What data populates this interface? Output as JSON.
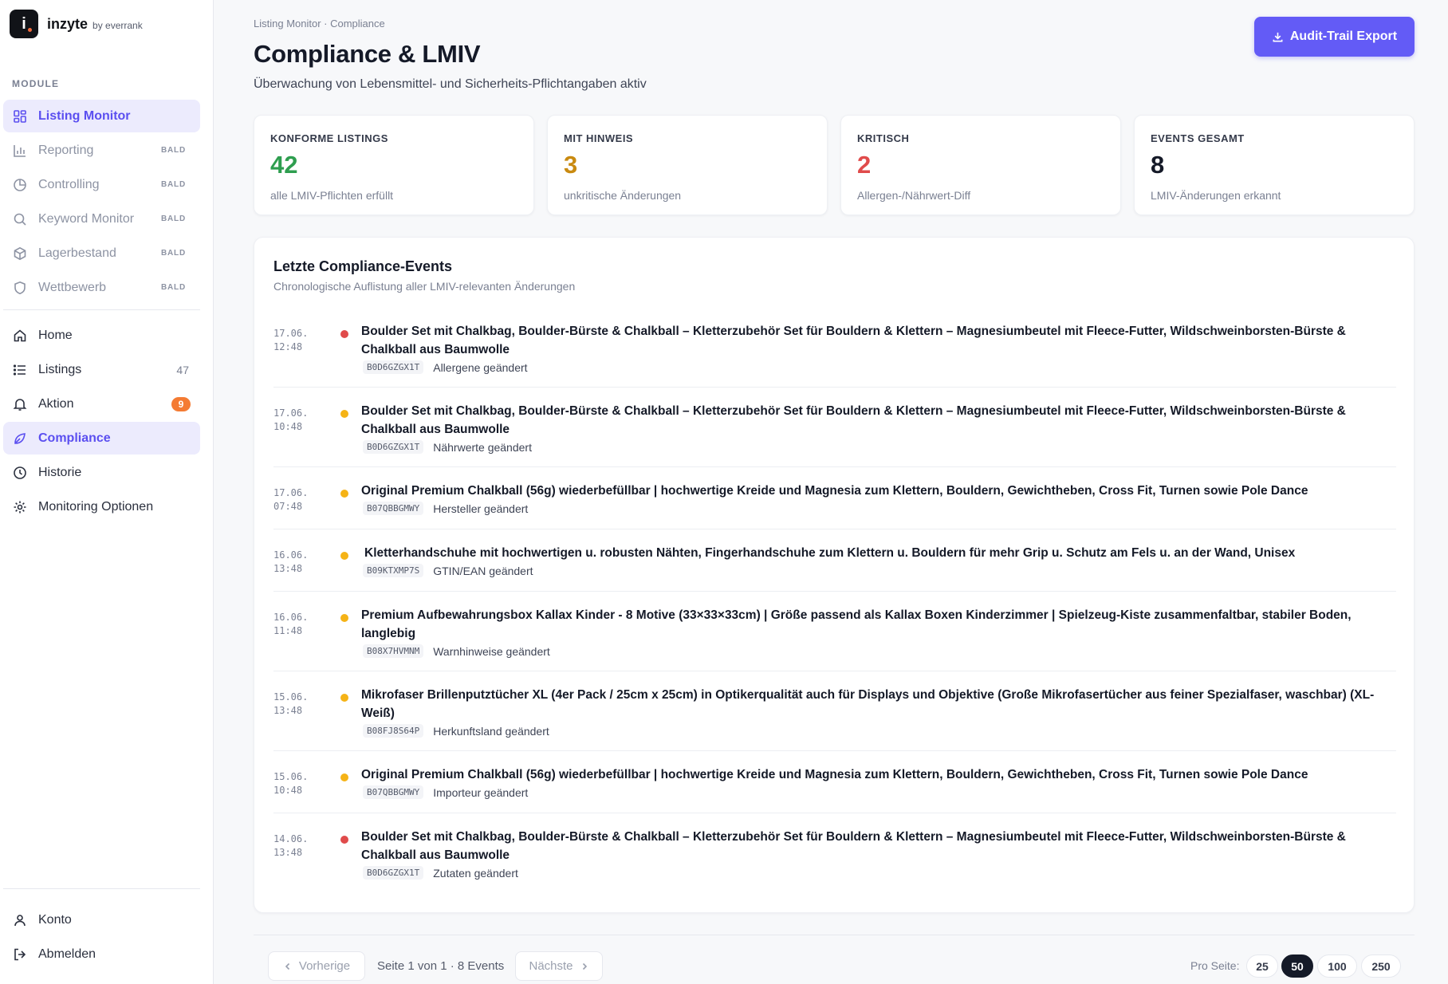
{
  "brand": {
    "name": "inzyte",
    "sub": "by everrank",
    "logo_letter": "i"
  },
  "sidebar": {
    "section_label": "MODULE",
    "modules": [
      {
        "label": "Listing Monitor",
        "icon": "grid-icon",
        "active": true,
        "tag": ""
      },
      {
        "label": "Reporting",
        "icon": "bar-chart-icon",
        "tag": "BALD"
      },
      {
        "label": "Controlling",
        "icon": "pie-chart-icon",
        "tag": "BALD"
      },
      {
        "label": "Keyword Monitor",
        "icon": "search-icon",
        "tag": "BALD"
      },
      {
        "label": "Lagerbestand",
        "icon": "box-icon",
        "tag": "BALD"
      },
      {
        "label": "Wettbewerb",
        "icon": "shield-icon",
        "tag": "BALD"
      }
    ],
    "nav": [
      {
        "label": "Home",
        "icon": "home-icon"
      },
      {
        "label": "Listings",
        "icon": "list-icon",
        "count": "47"
      },
      {
        "label": "Aktion",
        "icon": "bell-icon",
        "badge": "9"
      },
      {
        "label": "Compliance",
        "icon": "leaf-icon",
        "active": true
      },
      {
        "label": "Historie",
        "icon": "clock-icon"
      },
      {
        "label": "Monitoring Optionen",
        "icon": "gear-icon"
      }
    ],
    "bottom": [
      {
        "label": "Konto",
        "icon": "user-icon"
      },
      {
        "label": "Abmelden",
        "icon": "logout-icon"
      }
    ]
  },
  "header": {
    "breadcrumb": "Listing Monitor · Compliance",
    "title": "Compliance & LMIV",
    "subtitle": "Überwachung von Lebensmittel- und Sicherheits-Pflichtangaben aktiv",
    "export_label": "Audit-Trail Export"
  },
  "stats": [
    {
      "label": "KONFORME LISTINGS",
      "value": "42",
      "desc": "alle LMIV-Pflichten erfüllt",
      "color": "#2e9e4f"
    },
    {
      "label": "MIT HINWEIS",
      "value": "3",
      "desc": "unkritische Änderungen",
      "color": "#c98a10"
    },
    {
      "label": "KRITISCH",
      "value": "2",
      "desc": "Allergen-/Nährwert-Diff",
      "color": "#e04b4b"
    },
    {
      "label": "EVENTS GESAMT",
      "value": "8",
      "desc": "LMIV-Änderungen erkannt",
      "color": "#151a28"
    }
  ],
  "events_panel": {
    "title": "Letzte Compliance-Events",
    "subtitle": "Chronologische Auflistung aller LMIV-relevanten Änderungen"
  },
  "events": [
    {
      "date": "17.06.",
      "time": "12:48",
      "severity": "red",
      "title": "Boulder Set mit Chalkbag, Boulder-Bürste & Chalkball – Kletterzubehör Set für Bouldern & Klettern – Magnesiumbeutel mit Fleece-Futter, Wildschweinborsten-Bürste & Chalkball aus Baumwolle",
      "asin": "B0D6GZGX1T",
      "change": "Allergene geändert"
    },
    {
      "date": "17.06.",
      "time": "10:48",
      "severity": "amber",
      "title": "Boulder Set mit Chalkbag, Boulder-Bürste & Chalkball – Kletterzubehör Set für Bouldern & Klettern – Magnesiumbeutel mit Fleece-Futter, Wildschweinborsten-Bürste & Chalkball aus Baumwolle",
      "asin": "B0D6GZGX1T",
      "change": "Nährwerte geändert"
    },
    {
      "date": "17.06.",
      "time": "07:48",
      "severity": "amber",
      "title": "Original Premium Chalkball (56g) wiederbefüllbar | hochwertige Kreide und Magnesia zum Klettern, Bouldern, Gewichtheben, Cross Fit, Turnen sowie Pole Dance",
      "asin": "B07QBBGMWY",
      "change": "Hersteller geändert"
    },
    {
      "date": "16.06.",
      "time": "13:48",
      "severity": "amber",
      "title": "Kletterhandschuhe mit hochwertigen u. robusten Nähten, Fingerhandschuhe zum Klettern u. Bouldern für mehr Grip u. Schutz am Fels u. an der Wand, Unisex",
      "asin": "B09KTXMP7S",
      "change": "GTIN/EAN geändert"
    },
    {
      "date": "16.06.",
      "time": "11:48",
      "severity": "amber",
      "title": "Premium Aufbewahrungsbox Kallax Kinder - 8 Motive (33×33×33cm) | Größe passend als Kallax Boxen Kinderzimmer | Spielzeug-Kiste zusammenfaltbar, stabiler Boden, langlebig",
      "asin": "B08X7HVMNM",
      "change": "Warnhinweise geändert"
    },
    {
      "date": "15.06.",
      "time": "13:48",
      "severity": "amber",
      "title": "Mikrofaser Brillenputztücher XL (4er Pack / 25cm x 25cm) in Optikerqualität auch für Displays und Objektive (Große Mikrofasertücher aus feiner Spezialfaser, waschbar) (XL-Weiß)",
      "asin": "B08FJ8S64P",
      "change": "Herkunftsland geändert"
    },
    {
      "date": "15.06.",
      "time": "10:48",
      "severity": "amber",
      "title": "Original Premium Chalkball (56g) wiederbefüllbar | hochwertige Kreide und Magnesia zum Klettern, Bouldern, Gewichtheben, Cross Fit, Turnen sowie Pole Dance",
      "asin": "B07QBBGMWY",
      "change": "Importeur geändert"
    },
    {
      "date": "14.06.",
      "time": "13:48",
      "severity": "red",
      "title": "Boulder Set mit Chalkbag, Boulder-Bürste & Chalkball – Kletterzubehör Set für Bouldern & Klettern – Magnesiumbeutel mit Fleece-Futter, Wildschweinborsten-Bürste & Chalkball aus Baumwolle",
      "asin": "B0D6GZGX1T",
      "change": "Zutaten geändert"
    }
  ],
  "pagination": {
    "prev_label": "Vorherige",
    "next_label": "Nächste",
    "info": "Seite 1 von 1 · 8 Events",
    "per_page_label": "Pro Seite:",
    "per_page_options": [
      "25",
      "50",
      "100",
      "250"
    ],
    "per_page_selected": "50"
  },
  "colors": {
    "accent": "#635bf6",
    "active_bg": "#ecebfd",
    "badge": "#f47b33"
  }
}
